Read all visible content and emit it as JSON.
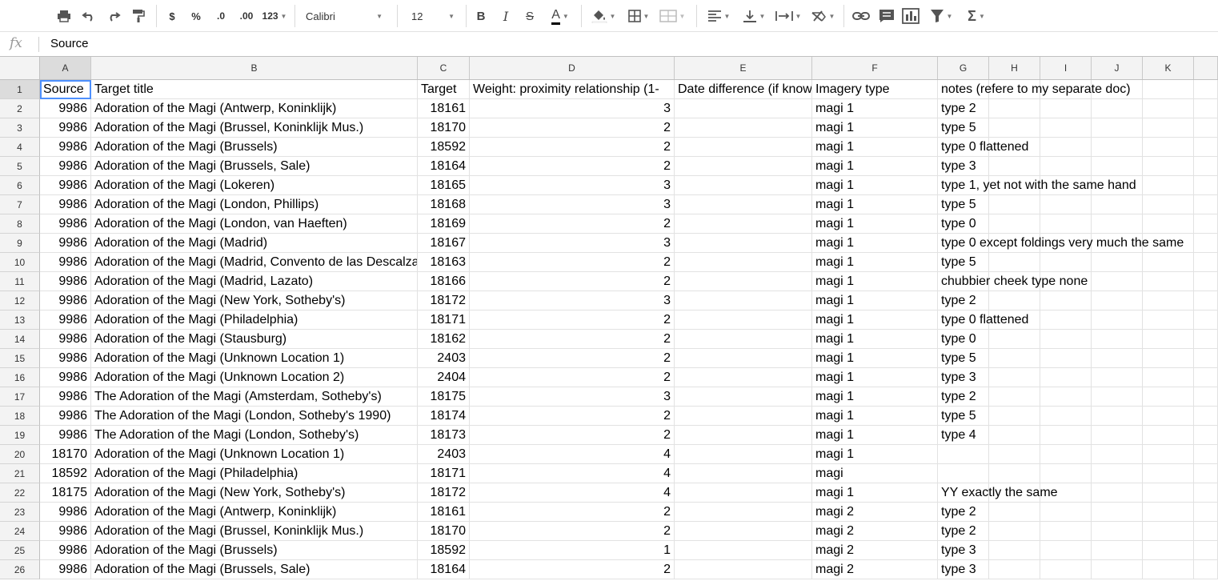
{
  "toolbar": {
    "currency": "$",
    "percent": "%",
    "dec_less": ".0",
    "dec_more": ".00",
    "format_more": "123",
    "font_name": "Calibri",
    "font_size": "12",
    "bold": "B",
    "italic": "I",
    "strike": "S",
    "text_color": "A",
    "functions": "Σ"
  },
  "formula_bar": {
    "fx_label": "fx",
    "value": "Source"
  },
  "columns": [
    "A",
    "B",
    "C",
    "D",
    "E",
    "F",
    "G",
    "H",
    "I",
    "J",
    "K"
  ],
  "row_numbers": [
    "1",
    "2",
    "3",
    "4",
    "5",
    "6",
    "7",
    "8",
    "9",
    "10",
    "11",
    "12",
    "13",
    "14",
    "15",
    "16",
    "17",
    "18",
    "19",
    "20",
    "21",
    "22",
    "23",
    "24",
    "25",
    "26"
  ],
  "rows": [
    [
      "Source",
      "Target title",
      "Target",
      "Weight: proximity relationship (1-",
      "Date difference (if known)",
      "Imagery type",
      "notes (refere to my separate doc)"
    ],
    [
      "9986",
      "Adoration of the Magi (Antwerp, Koninklijk)",
      "18161",
      "3",
      "",
      "magi 1",
      "type 2"
    ],
    [
      "9986",
      "Adoration of the Magi (Brussel, Koninklijk Mus.)",
      "18170",
      "2",
      "",
      "magi 1",
      "type 5"
    ],
    [
      "9986",
      "Adoration of the Magi (Brussels)",
      "18592",
      "2",
      "",
      "magi 1",
      "type 0 flattened"
    ],
    [
      "9986",
      "Adoration of the Magi (Brussels, Sale)",
      "18164",
      "2",
      "",
      "magi 1",
      "type 3"
    ],
    [
      "9986",
      "Adoration of the Magi (Lokeren)",
      "18165",
      "3",
      "",
      "magi 1",
      "type 1, yet not with the same hand"
    ],
    [
      "9986",
      "Adoration of the Magi (London, Phillips)",
      "18168",
      "3",
      "",
      "magi 1",
      "type 5"
    ],
    [
      "9986",
      "Adoration of the Magi (London, van Haeften)",
      "18169",
      "2",
      "",
      "magi 1",
      "type 0"
    ],
    [
      "9986",
      "Adoration of the Magi (Madrid)",
      "18167",
      "3",
      "",
      "magi 1",
      "type 0 except foldings very much the same"
    ],
    [
      "9986",
      "Adoration of the Magi (Madrid, Convento de las Descalzas Reales)",
      "18163",
      "2",
      "",
      "magi 1",
      "type 5"
    ],
    [
      "9986",
      "Adoration of the Magi (Madrid, Lazato)",
      "18166",
      "2",
      "",
      "magi 1",
      "chubbier cheek type none"
    ],
    [
      "9986",
      "Adoration of the Magi (New York, Sotheby's)",
      "18172",
      "3",
      "",
      "magi 1",
      "type 2"
    ],
    [
      "9986",
      "Adoration of the Magi (Philadelphia)",
      "18171",
      "2",
      "",
      "magi 1",
      "type 0 flattened"
    ],
    [
      "9986",
      "Adoration of the Magi (Stausburg)",
      "18162",
      "2",
      "",
      "magi 1",
      "type 0"
    ],
    [
      "9986",
      "Adoration of the Magi (Unknown Location 1)",
      "2403",
      "2",
      "",
      "magi 1",
      "type 5"
    ],
    [
      "9986",
      "Adoration of the Magi (Unknown Location 2)",
      "2404",
      "2",
      "",
      "magi 1",
      "type 3"
    ],
    [
      "9986",
      "The Adoration of the Magi (Amsterdam, Sotheby's)",
      "18175",
      "3",
      "",
      "magi 1",
      "type 2"
    ],
    [
      "9986",
      "The Adoration of the Magi (London, Sotheby's 1990)",
      "18174",
      "2",
      "",
      "magi 1",
      "type 5"
    ],
    [
      "9986",
      "The Adoration of the Magi (London, Sotheby's)",
      "18173",
      "2",
      "",
      "magi 1",
      "type 4"
    ],
    [
      "18170",
      "Adoration of the Magi (Unknown Location 1)",
      "2403",
      "4",
      "",
      "magi 1",
      ""
    ],
    [
      "18592",
      "Adoration of the Magi (Philadelphia)",
      "18171",
      "4",
      "",
      "magi",
      ""
    ],
    [
      "18175",
      "Adoration of the Magi (New York, Sotheby's)",
      "18172",
      "4",
      "",
      "magi 1",
      "YY exactly the same"
    ],
    [
      "9986",
      "Adoration of the Magi (Antwerp, Koninklijk)",
      "18161",
      "2",
      "",
      "magi 2",
      "type 2"
    ],
    [
      "9986",
      "Adoration of the Magi (Brussel, Koninklijk Mus.)",
      "18170",
      "2",
      "",
      "magi 2",
      "type 2"
    ],
    [
      "9986",
      "Adoration of the Magi (Brussels)",
      "18592",
      "1",
      "",
      "magi 2",
      "type 3"
    ],
    [
      "9986",
      "Adoration of the Magi (Brussels, Sale)",
      "18164",
      "2",
      "",
      "magi 2",
      "type 3"
    ]
  ]
}
